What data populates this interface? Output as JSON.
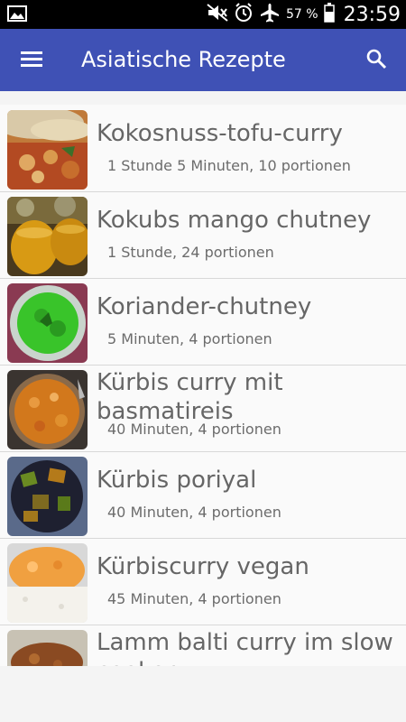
{
  "status_bar": {
    "battery_percent": "57 %",
    "time": "23:59",
    "icons": [
      "image-icon",
      "mute-icon",
      "alarm-icon",
      "airplane-mode-icon",
      "battery-icon"
    ]
  },
  "app_bar": {
    "title": "Asiatische Rezepte",
    "menu_icon": "hamburger-menu-icon",
    "search_icon": "search-icon",
    "color": "#3f51b5"
  },
  "recipes": [
    {
      "title": "Kokosnuss-tofu-curry",
      "meta": "1 Stunde 5 Minuten, 10 portionen"
    },
    {
      "title": "Kokubs mango chutney",
      "meta": "1 Stunde, 24 portionen"
    },
    {
      "title": "Koriander-chutney",
      "meta": "5 Minuten, 4 portionen"
    },
    {
      "title": "Kürbis curry mit\nbasmatireis",
      "meta": "40 Minuten, 4 portionen"
    },
    {
      "title": "Kürbis poriyal",
      "meta": "40 Minuten, 4 portionen"
    },
    {
      "title": "Kürbiscurry vegan",
      "meta": "45 Minuten, 4 portionen"
    },
    {
      "title": "Lamm balti curry im slow\ncooker",
      "meta": ""
    }
  ]
}
